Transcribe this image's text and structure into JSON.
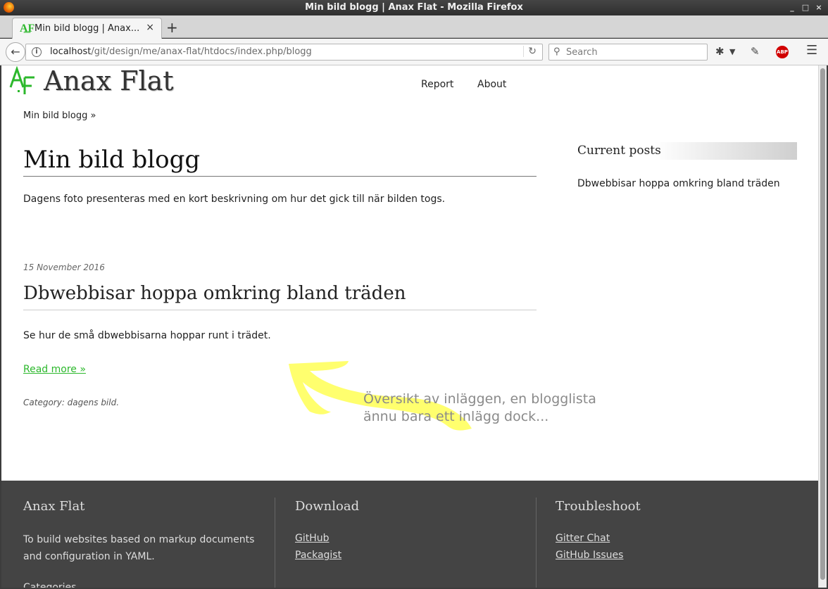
{
  "window": {
    "title": "Min bild blogg | Anax Flat - Mozilla Firefox",
    "controls": [
      "_",
      "□",
      "×"
    ]
  },
  "tabs": [
    {
      "label": "Min bild blogg | Anax...",
      "close": "×"
    }
  ],
  "newtab_label": "+",
  "navbar": {
    "url_host": "localhost",
    "url_path": "/git/design/me/anax-flat/htdocs/index.php/blogg",
    "search_placeholder": "Search",
    "abp_label": "ABP"
  },
  "site": {
    "logo_text": "Anax Flat",
    "nav": [
      "Report",
      "About"
    ],
    "breadcrumb": "Min bild blogg »",
    "accent_color": "#2cb82c"
  },
  "main": {
    "title": "Min bild blogg",
    "intro": "Dagens foto presenteras med en kort beskrivning om hur det gick till när bilden togs.",
    "post": {
      "date": "15 November 2016",
      "title": "Dbwebbisar hoppa omkring bland träden",
      "excerpt": "Se hur de små dbwebbisarna hoppar runt i trädet.",
      "read_more": "Read more »",
      "category": "Category: dagens bild."
    }
  },
  "aside": {
    "title": "Current posts",
    "items": [
      "Dbwebbisar hoppa omkring bland träden"
    ]
  },
  "annotation": {
    "line1": "Översikt av inläggen, en blogglista",
    "line2": "ännu bara ett inlägg dock...",
    "arrow_color": "#ffff55"
  },
  "footer": {
    "col1": {
      "title": "Anax Flat",
      "text": "To build websites based on markup documents and configuration in YAML.",
      "cut_text": "Categories"
    },
    "col2": {
      "title": "Download",
      "links": [
        "GitHub",
        "Packagist"
      ]
    },
    "col3": {
      "title": "Troubleshoot",
      "links": [
        "Gitter Chat",
        "GitHub Issues"
      ]
    }
  }
}
